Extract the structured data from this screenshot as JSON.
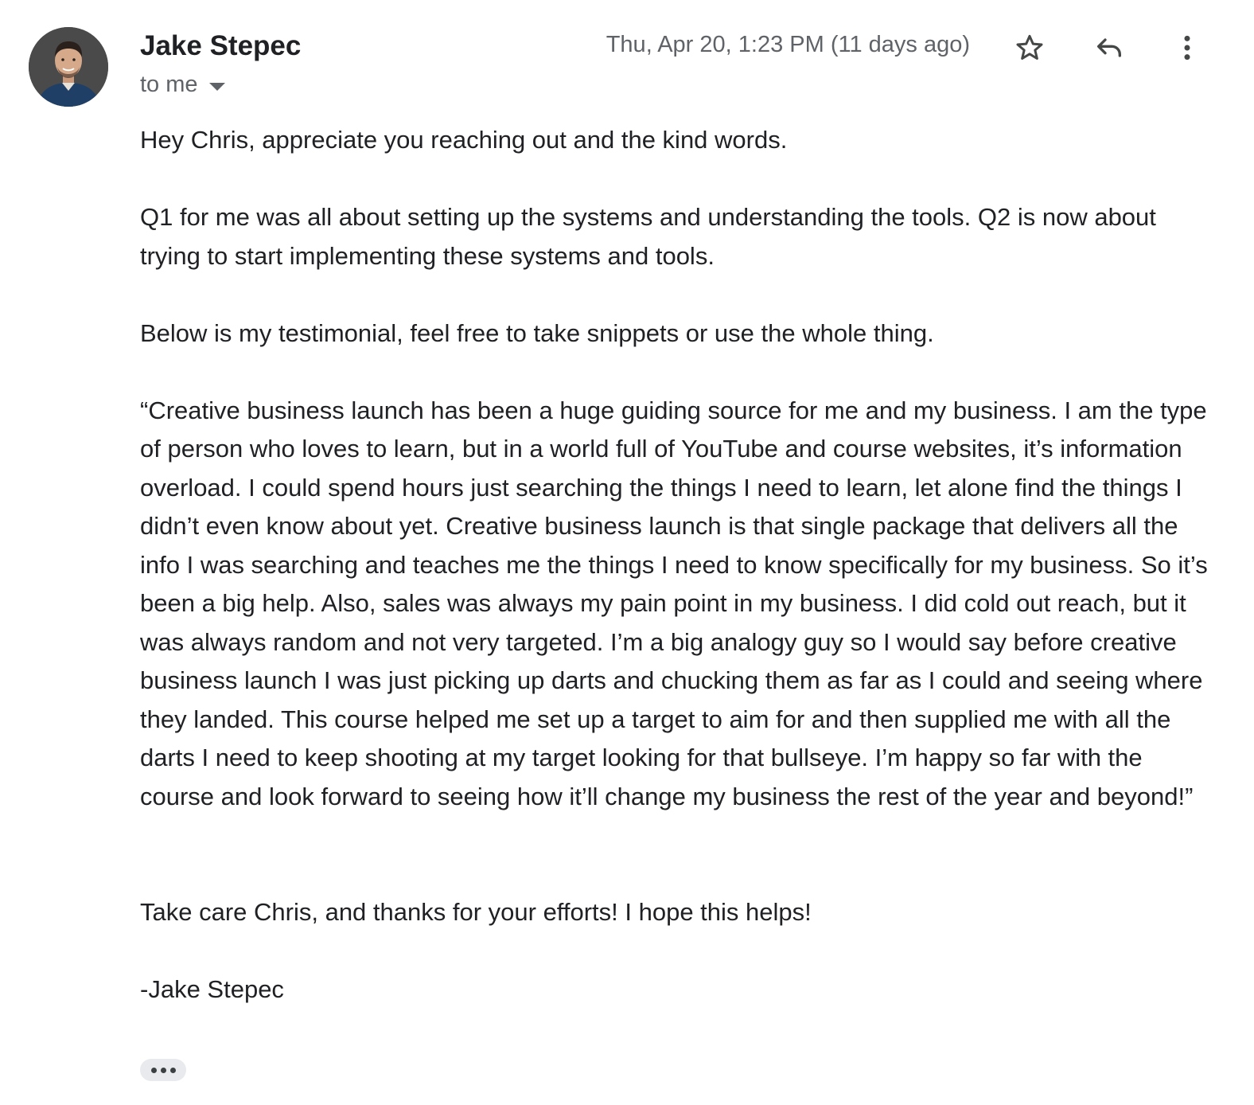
{
  "sender": {
    "name": "Jake Stepec",
    "avatar_icon": "person-avatar"
  },
  "recipient": {
    "label": "to me"
  },
  "timestamp": "Thu, Apr 20, 1:23 PM (11 days ago)",
  "actions": {
    "star_icon": "star-outline-icon",
    "reply_icon": "reply-arrow-icon",
    "more_icon": "vertical-dots-icon"
  },
  "body": {
    "greeting": "Hey Chris, appreciate you reaching out and the kind words.",
    "paragraph_q": "Q1 for me was all about setting up the systems and understanding the tools. Q2 is now about trying to start implementing these systems and tools.",
    "paragraph_intro": "Below is my testimonial, feel free to take snippets or use the whole thing.",
    "testimonial": "“Creative business launch has been a huge guiding source for me and my business. I am the type of person who loves to learn, but in a world full of YouTube and course websites, it’s information overload. I could spend hours just searching the things I need to learn, let alone find the things I didn’t even know about yet. Creative business launch is that single package that delivers all the info I was searching and teaches me the things I need to know specifically for my business. So it’s been a big help. Also, sales was always my pain point in my business. I did cold out reach, but it was always random and not very targeted. I’m a big analogy guy so I would say before creative business launch I was just picking up darts and chucking them as far as I could and seeing where they landed. This course helped me set up a target to aim for and then supplied me with all the darts I need to keep shooting at my target looking for that bullseye. I’m happy so far with the course and look forward to seeing how it’ll change my business the rest of the year and beyond!”",
    "closing": "Take care Chris, and thanks for your efforts! I hope this helps!",
    "signature": "-Jake Stepec"
  },
  "trimmed_content_icon": "ellipsis-icon"
}
